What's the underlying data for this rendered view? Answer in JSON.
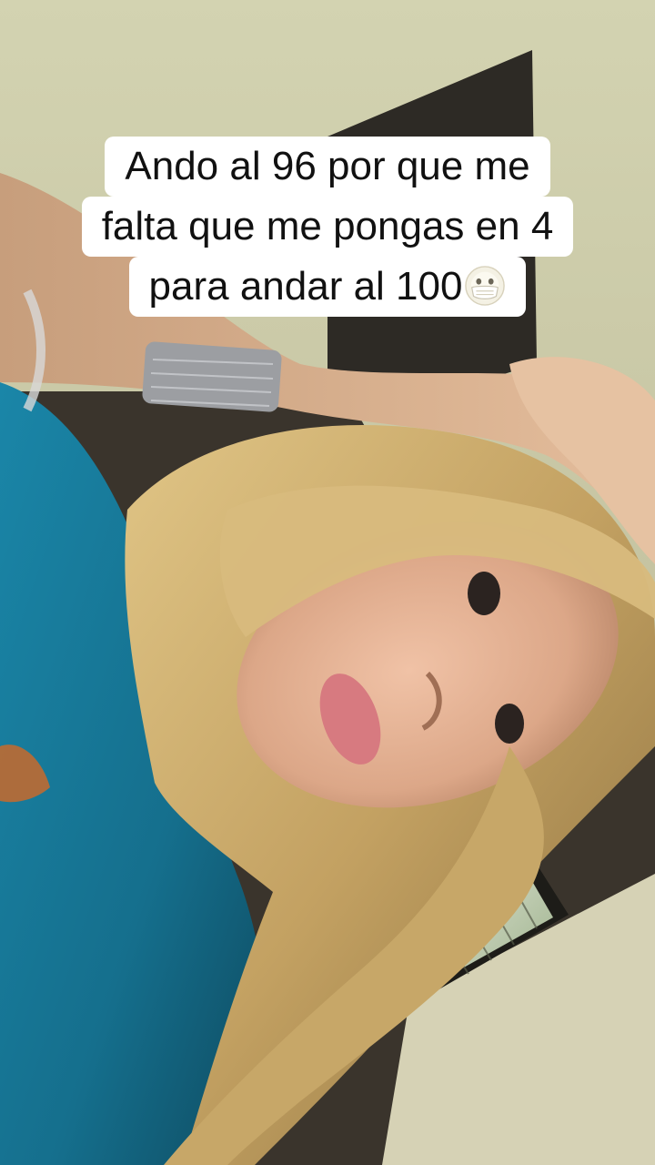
{
  "overlay": {
    "caption_lines": [
      "Ando al 96 por que me",
      "falta que me pongas en 4",
      "para andar al 100"
    ],
    "caption_emoji": "face-with-medical-mask-emoji"
  },
  "colors": {
    "caption_background": "#ffffff",
    "caption_text": "#111111",
    "wall": "#c8c6a4",
    "shirt": "#1c7d9e",
    "hair": "#c7a768",
    "skin": "#e2b496"
  }
}
